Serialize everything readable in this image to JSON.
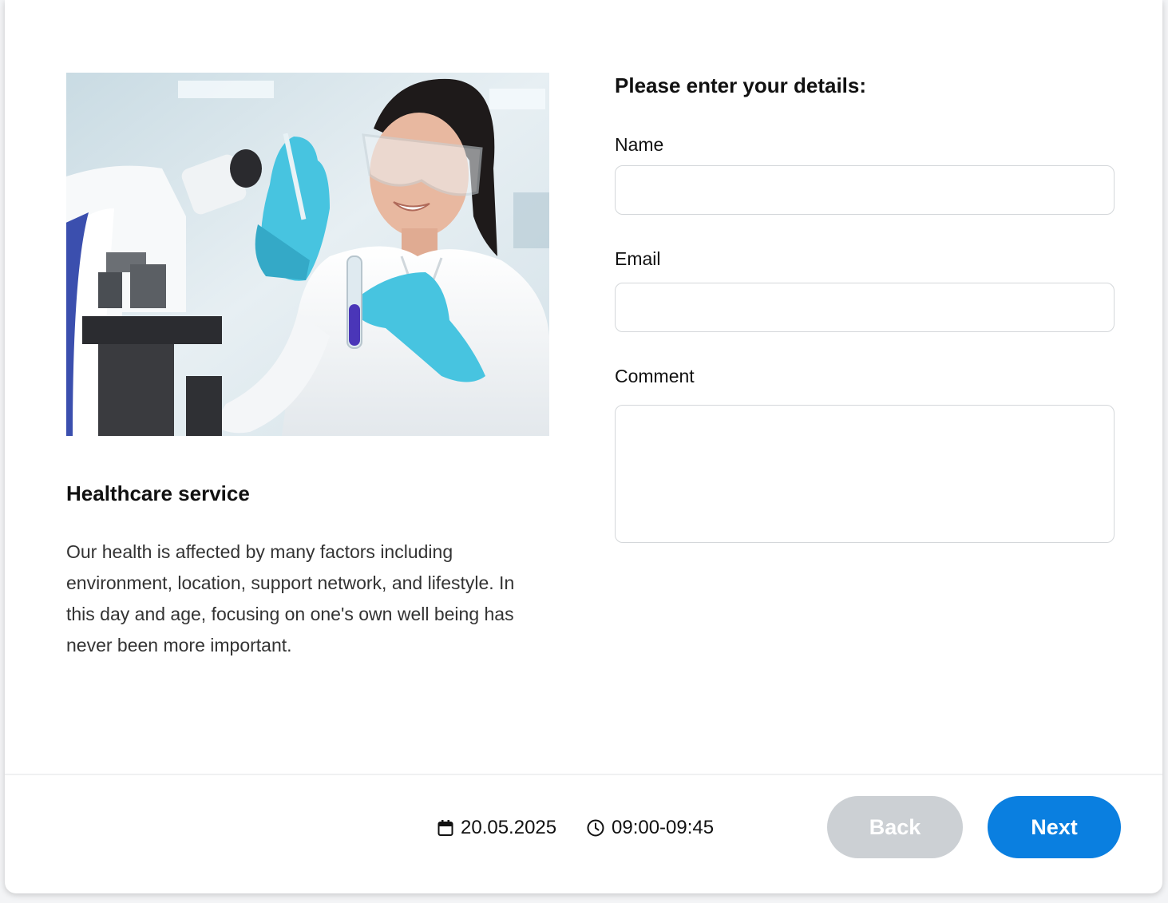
{
  "service": {
    "image_alt": "Lab scientist with microscope and test tube",
    "title": "Healthcare service",
    "description": "Our health is affected by many factors including environment, location, support network, and lifestyle. In this day and age, focusing on one's own well being has never been more important."
  },
  "form": {
    "heading": "Please enter your details:",
    "name_label": "Name",
    "name_value": "",
    "email_label": "Email",
    "email_value": "",
    "comment_label": "Comment",
    "comment_value": ""
  },
  "footer": {
    "date": "20.05.2025",
    "date_icon": "calendar-icon",
    "time": "09:00-09:45",
    "time_icon": "clock-icon",
    "back_label": "Back",
    "next_label": "Next"
  },
  "colors": {
    "primary": "#0a7fe0",
    "disabled": "#ccd0d4"
  }
}
